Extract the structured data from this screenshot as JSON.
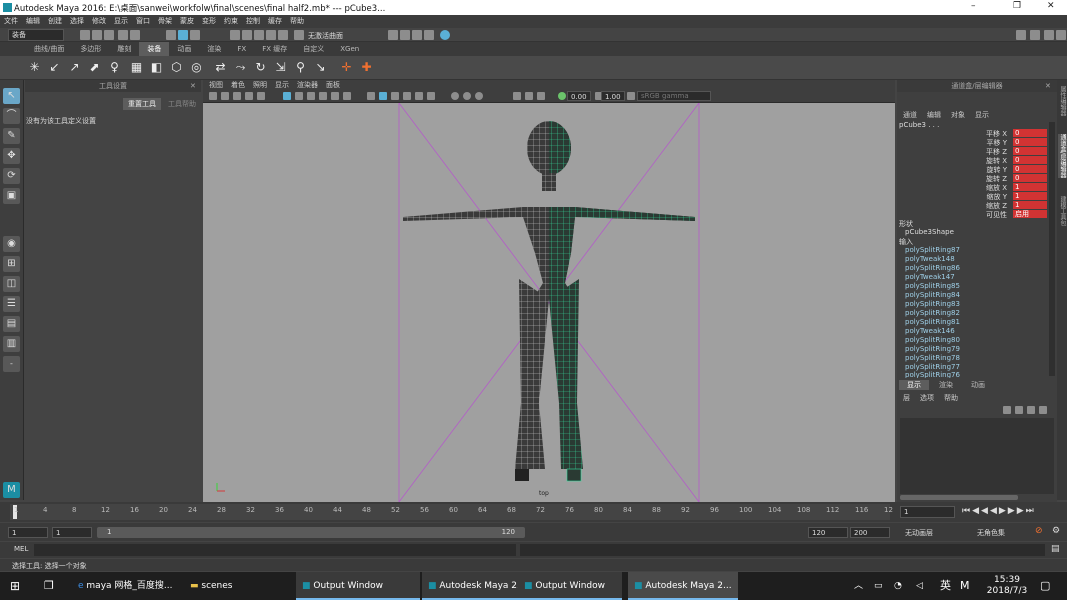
{
  "window": {
    "title": "Autodesk Maya 2016: E:\\桌面\\sanwei\\workfolw\\final\\scenes\\final half2.mb*  ---  pCube3...",
    "min": "–",
    "max": "❐",
    "close": "✕"
  },
  "menus": [
    "文件",
    "编辑",
    "创建",
    "选择",
    "修改",
    "显示",
    "窗口",
    "骨架",
    "蒙皮",
    "变形",
    "约束",
    "控制",
    "缓存",
    "帮助"
  ],
  "status": {
    "mode": "装备",
    "live_surface": "无激活曲面"
  },
  "shelf_tabs": [
    "曲线/曲面",
    "多边形",
    "雕刻",
    "装备",
    "动画",
    "渲染",
    "FX",
    "FX 缓存",
    "自定义",
    "XGen"
  ],
  "shelf_active": "装备",
  "tool_settings": {
    "title": "工具设置",
    "reset": "重置工具",
    "help": "工具帮助",
    "message": "没有为该工具定义设置"
  },
  "viewport": {
    "menu": [
      "视图",
      "着色",
      "照明",
      "显示",
      "渲染器",
      "面板"
    ],
    "value1": "0.00",
    "value2": "1.00",
    "colorspace": "sRGB gamma",
    "camera": "top"
  },
  "channel_box": {
    "title": "通道盒/层编辑器",
    "menu": [
      "通道",
      "编辑",
      "对象",
      "显示"
    ],
    "object": "pCube3 . . .",
    "channels": [
      {
        "name": "平移 X",
        "value": "0"
      },
      {
        "name": "平移 Y",
        "value": "0"
      },
      {
        "name": "平移 Z",
        "value": "0"
      },
      {
        "name": "旋转 X",
        "value": "0"
      },
      {
        "name": "旋转 Y",
        "value": "0"
      },
      {
        "name": "旋转 Z",
        "value": "0"
      },
      {
        "name": "缩放 X",
        "value": "1"
      },
      {
        "name": "缩放 Y",
        "value": "1"
      },
      {
        "name": "缩放 Z",
        "value": "1"
      },
      {
        "name": "可见性",
        "value": "启用"
      }
    ],
    "shapes_label": "形状",
    "shape": "pCube3Shape",
    "inputs_label": "输入",
    "history": [
      "polySplitRing87",
      "polyTweak148",
      "polySplitRing86",
      "polyTweak147",
      "polySplitRing85",
      "polySplitRing84",
      "polySplitRing83",
      "polySplitRing82",
      "polySplitRing81",
      "polyTweak146",
      "polySplitRing80",
      "polySplitRing79",
      "polySplitRing78",
      "polySplitRing77",
      "polySplitRing76"
    ]
  },
  "layer_panel": {
    "tabs": [
      "显示",
      "渲染",
      "动画"
    ],
    "menu": [
      "层",
      "选项",
      "帮助"
    ]
  },
  "side_tabs": [
    "属性编辑器",
    "通道盒/层编辑器",
    "建模工具包"
  ],
  "time_slider": {
    "ticks": [
      "1",
      "4",
      "8",
      "12",
      "16",
      "20",
      "24",
      "28",
      "32",
      "36",
      "40",
      "44",
      "48",
      "52",
      "56",
      "60",
      "64",
      "68",
      "72",
      "76",
      "80",
      "84",
      "88",
      "92",
      "96",
      "100",
      "104",
      "108",
      "112",
      "116",
      "12"
    ],
    "current": "1"
  },
  "range_slider": {
    "start": "1",
    "start2": "1",
    "inner_start": "1",
    "inner_end": "120",
    "end": "120",
    "end2": "200",
    "anim_layer": "无动画层",
    "char_set": "无角色集"
  },
  "cmd": {
    "label": "MEL"
  },
  "help_line": "选择工具: 选择一个对象",
  "taskbar": {
    "items": [
      "maya 网格_百度搜...",
      "scenes",
      "Output Window",
      "Autodesk Maya 2...",
      "Output Window",
      "Autodesk Maya 2..."
    ],
    "ime": "英",
    "ime2": "M",
    "time": "15:39",
    "date": "2018/7/3"
  },
  "colors": {
    "accent": "#5ab0d6",
    "keyed": "#d23333",
    "selection_green": "#35e0a0",
    "mesh": "#1a1a1a"
  }
}
